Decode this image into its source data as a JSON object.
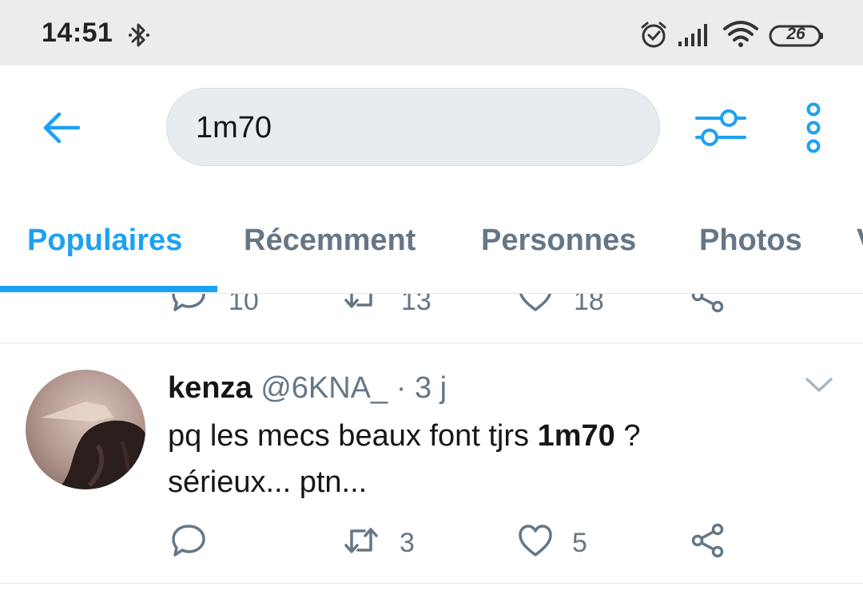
{
  "status_bar": {
    "time": "14:51",
    "battery": "26",
    "icons": [
      "bluetooth-icon",
      "alarm-icon",
      "signal-icon",
      "wifi-icon",
      "battery-icon"
    ]
  },
  "header": {
    "back_icon": "arrow-left-icon",
    "search_query": "1m70",
    "filter_icon": "sliders-icon",
    "more_icon": "more-vertical-icon"
  },
  "tabs": [
    {
      "label": "Populaires",
      "active": true
    },
    {
      "label": "Récemment",
      "active": false
    },
    {
      "label": "Personnes",
      "active": false
    },
    {
      "label": "Photos",
      "active": false
    },
    {
      "label": "V",
      "active": false
    }
  ],
  "previous_tweet_actions": {
    "replies": "10",
    "retweets": "13",
    "likes": "18"
  },
  "tweet": {
    "name": "kenza",
    "handle": "@6KNA_",
    "separator": "·",
    "time": "3 j",
    "text_before": "pq les mecs beaux font tjrs ",
    "text_highlight": "1m70",
    "text_after": " ?",
    "text_line2": "sérieux... ptn...",
    "replies": "",
    "retweets": "3",
    "likes": "5"
  },
  "colors": {
    "accent": "#1da1f2",
    "muted": "#657786",
    "status_bar_bg": "#ececec",
    "search_bg": "#e6ecf0"
  }
}
